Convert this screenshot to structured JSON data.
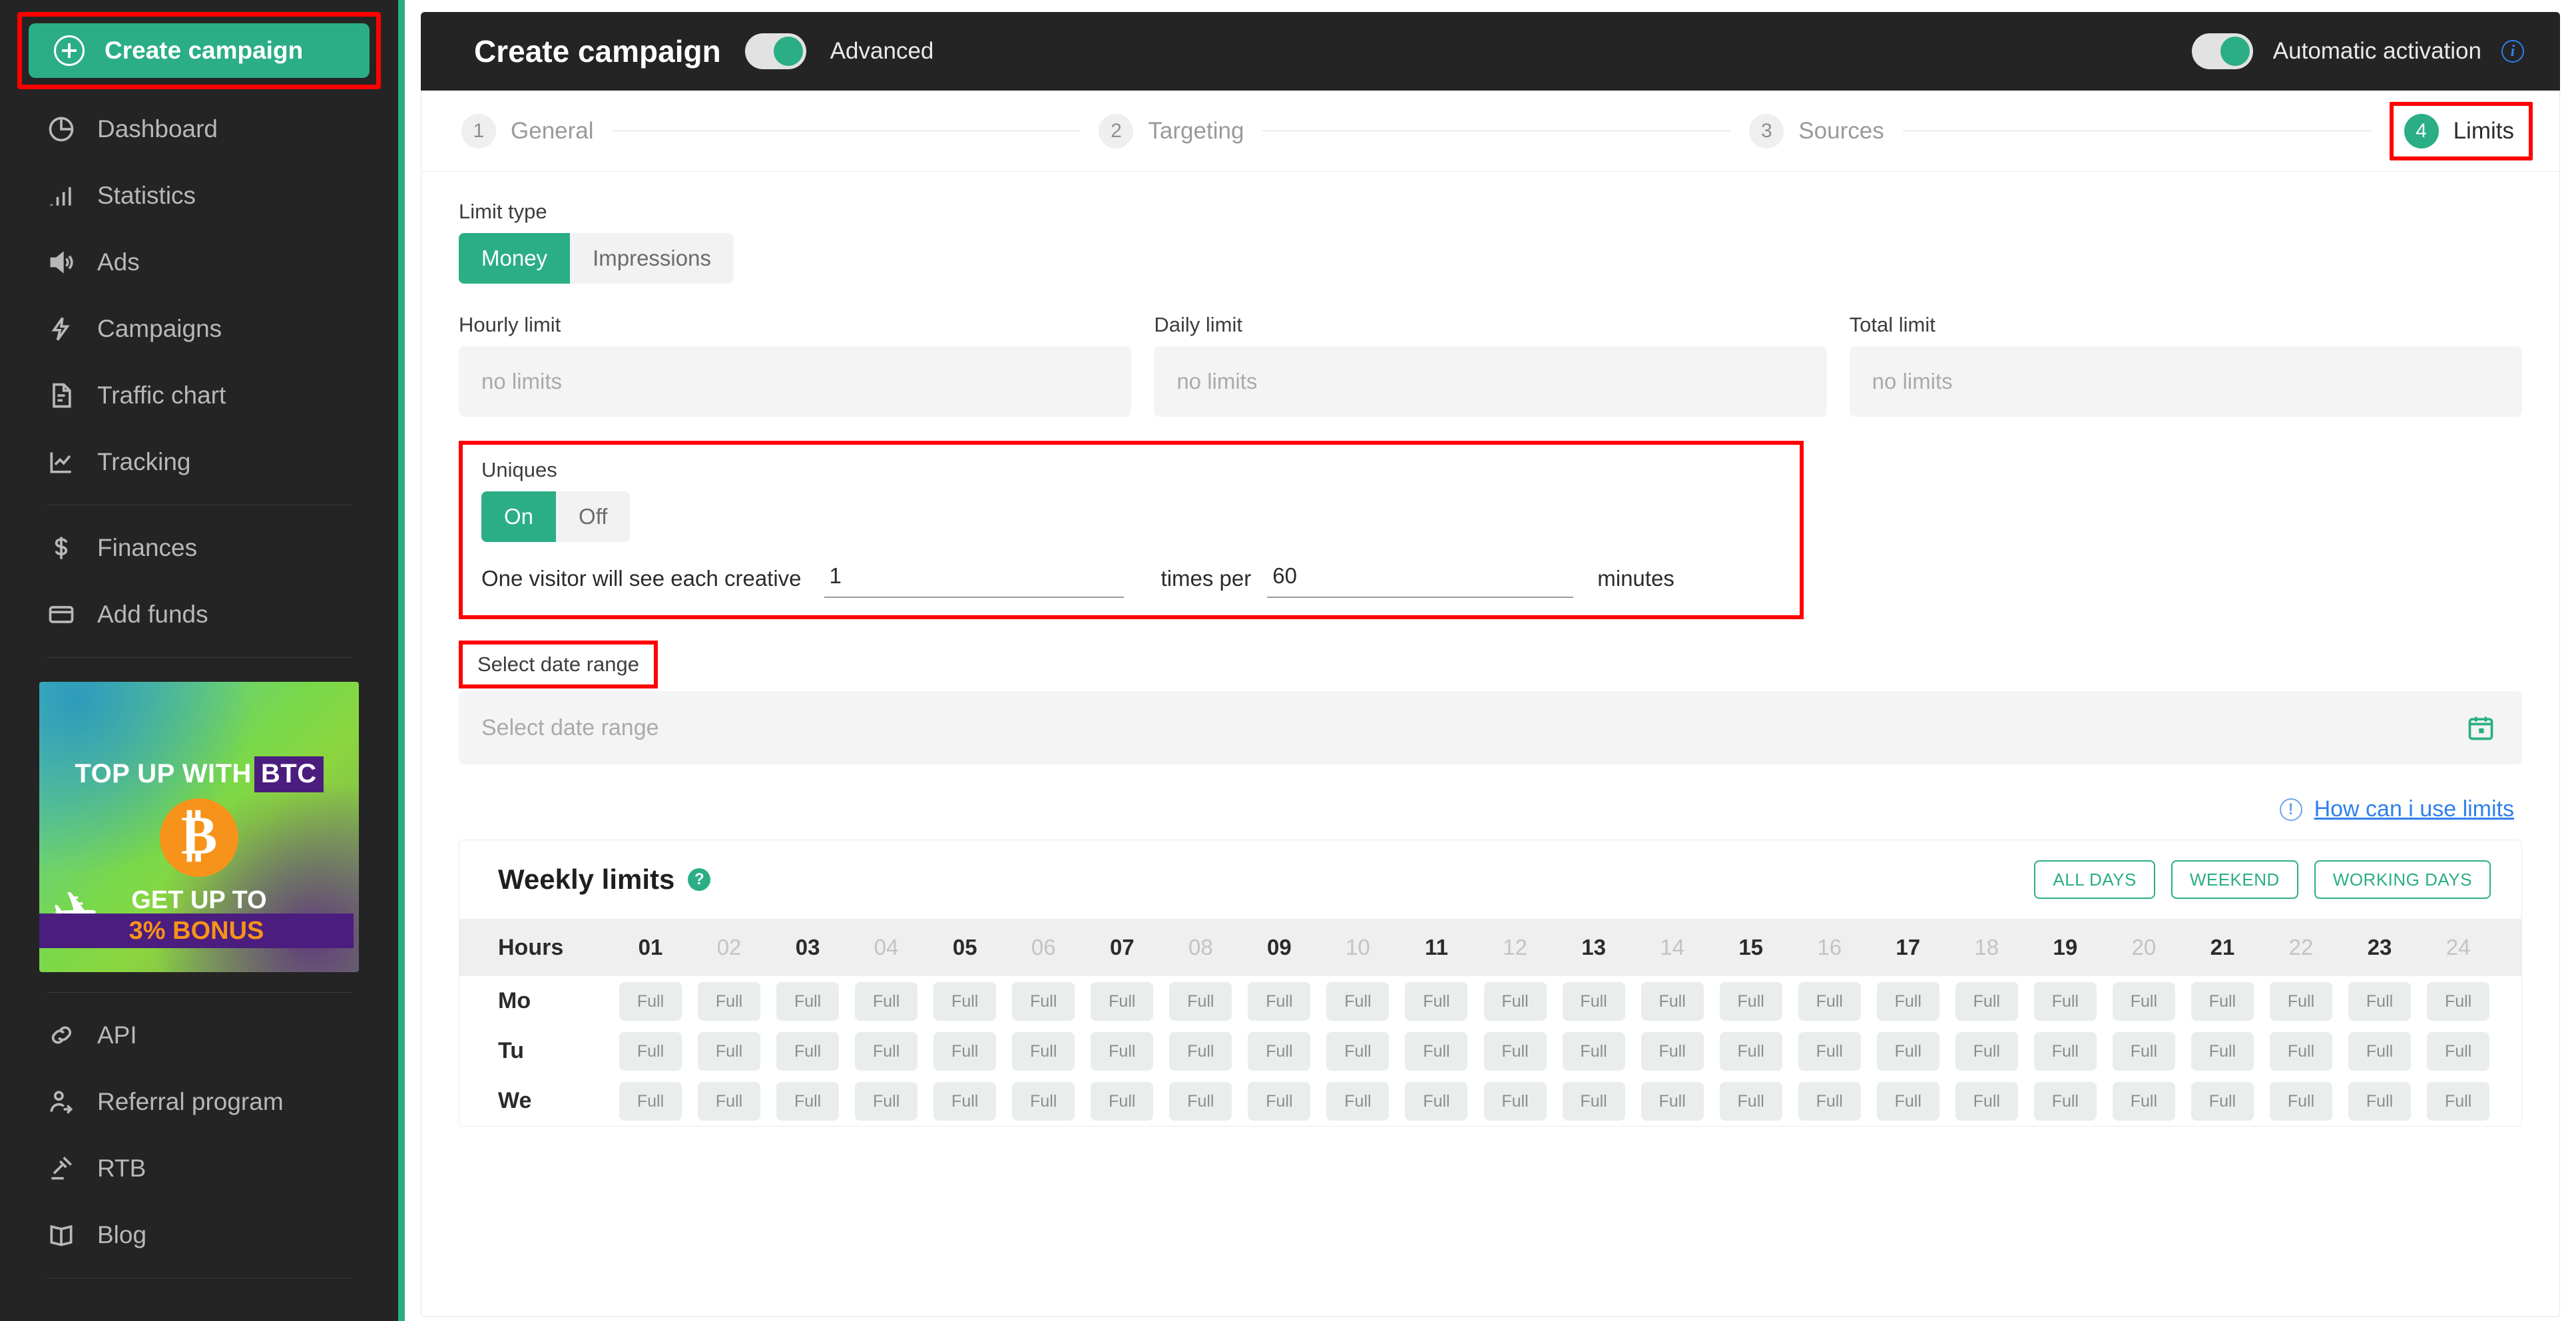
{
  "sidebar": {
    "create_button": {
      "label": "Create campaign",
      "icon": "plus-circle-icon"
    },
    "groups": [
      {
        "items": [
          {
            "label": "Dashboard",
            "icon": "pie-chart-icon"
          },
          {
            "label": "Statistics",
            "icon": "bar-chart-icon"
          },
          {
            "label": "Ads",
            "icon": "speaker-icon"
          },
          {
            "label": "Campaigns",
            "icon": "lightning-icon"
          },
          {
            "label": "Traffic chart",
            "icon": "document-icon"
          },
          {
            "label": "Tracking",
            "icon": "line-chart-icon"
          }
        ]
      },
      {
        "items": [
          {
            "label": "Finances",
            "icon": "dollar-icon"
          },
          {
            "label": "Add funds",
            "icon": "credit-card-icon"
          }
        ]
      }
    ],
    "banner": {
      "line1_a": "TOP UP WITH",
      "line1_b": "BTC",
      "coin_symbol": "₿",
      "line2": "GET UP TO",
      "line3": "3% BONUS",
      "bird_glyph": "✈"
    },
    "bottom_items": [
      {
        "label": "API",
        "icon": "link-icon"
      },
      {
        "label": "Referral program",
        "icon": "user-add-icon"
      },
      {
        "label": "RTB",
        "icon": "gavel-icon"
      },
      {
        "label": "Blog",
        "icon": "book-icon"
      }
    ]
  },
  "topbar": {
    "title": "Create campaign",
    "advanced_label": "Advanced",
    "advanced_on": true,
    "automatic_activation_label": "Automatic activation",
    "automatic_activation_on": true,
    "info_glyph": "i"
  },
  "stepper": {
    "steps": [
      {
        "num": "1",
        "label": "General",
        "active": false
      },
      {
        "num": "2",
        "label": "Targeting",
        "active": false
      },
      {
        "num": "3",
        "label": "Sources",
        "active": false
      },
      {
        "num": "4",
        "label": "Limits",
        "active": true
      }
    ]
  },
  "limits": {
    "limit_type_label": "Limit type",
    "limit_type_options": [
      "Money",
      "Impressions"
    ],
    "limit_type_selected": "Money",
    "fields": [
      {
        "label": "Hourly limit",
        "placeholder": "no limits",
        "value": ""
      },
      {
        "label": "Daily limit",
        "placeholder": "no limits",
        "value": ""
      },
      {
        "label": "Total limit",
        "placeholder": "no limits",
        "value": ""
      }
    ],
    "uniques": {
      "label": "Uniques",
      "options": [
        "On",
        "Off"
      ],
      "selected": "On",
      "sentence_start": "One visitor will see each creative",
      "times_value": "1",
      "sentence_mid": "times per",
      "minutes_value": "60",
      "sentence_end": "minutes"
    },
    "date_range": {
      "label": "Select date range",
      "placeholder": "Select date range",
      "value": "",
      "icon": "calendar-icon"
    },
    "how_link": {
      "text": "How can i use limits",
      "icon_glyph": "!"
    }
  },
  "weekly": {
    "title": "Weekly limits",
    "help_glyph": "?",
    "actions": [
      "ALL DAYS",
      "WEEKEND",
      "WORKING DAYS"
    ],
    "hours_label": "Hours",
    "hours": [
      "01",
      "02",
      "03",
      "04",
      "05",
      "06",
      "07",
      "08",
      "09",
      "10",
      "11",
      "12",
      "13",
      "14",
      "15",
      "16",
      "17",
      "18",
      "19",
      "20",
      "21",
      "22",
      "23",
      "24"
    ],
    "days": [
      "Mo",
      "Tu",
      "We"
    ],
    "cell_label": "Full"
  },
  "colors": {
    "accent": "#2BAE85",
    "sidebar_bg": "#242424",
    "highlight": "#FF0000",
    "link": "#2F80ED"
  }
}
